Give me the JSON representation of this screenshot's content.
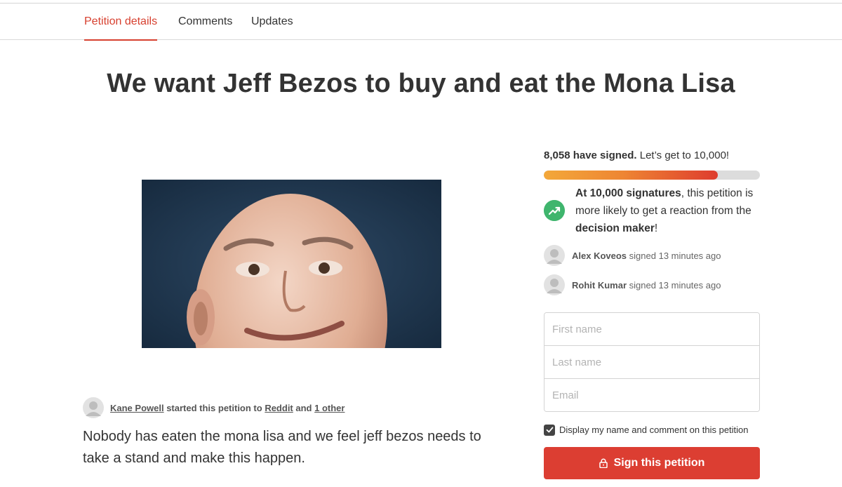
{
  "tabs": [
    "Petition details",
    "Comments",
    "Updates"
  ],
  "petition": {
    "title": "We want Jeff Bezos to buy and eat the Mona Lisa",
    "image_icon": "portrait-photo",
    "starter_name": "Kane Powell",
    "starter_text": " started this petition to ",
    "target": "Reddit",
    "and_text": " and ",
    "others": "1 other",
    "description": "Nobody has eaten the mona lisa and we feel jeff bezos needs to take a stand and make this happen."
  },
  "signatures": {
    "count_bold": "8,058 have signed.",
    "count_rest": "Let’s get to 10,000!",
    "progress": 0.8058,
    "goal_bold": "At 10,000 signatures",
    "goal_mid": ", this petition is more likely to get a reaction from the ",
    "goal_bold2": "decision maker",
    "goal_end": "!",
    "goal_icon": "trending-up-icon",
    "recent": [
      {
        "name": "Alex Koveos",
        "action": "signed 13 minutes ago"
      },
      {
        "name": "Rohit Kumar",
        "action": "signed 13 minutes ago"
      }
    ]
  },
  "form": {
    "first_name_placeholder": "First name",
    "last_name_placeholder": "Last name",
    "email_placeholder": "Email",
    "display_checkbox_label": "Display my name and comment on this petition",
    "display_checked": true,
    "sign_button": "Sign this petition"
  },
  "colors": {
    "accent": "#d7402f",
    "button": "#dc3e32",
    "progress_start": "#f3a83a",
    "progress_end": "#de3c2e",
    "success": "#3fb56d"
  }
}
